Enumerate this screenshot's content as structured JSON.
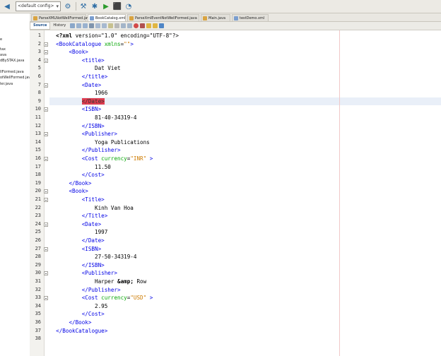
{
  "toolbar": {
    "config": "<default config>",
    "icons": [
      "back-icon",
      "gear-icon",
      "hammer-icon",
      "clean-build-icon",
      "run-icon",
      "debug-icon",
      "profile-icon"
    ]
  },
  "left_panel": {
    "items": [
      "e",
      "tax",
      "ava",
      "dBySTAX.java",
      "llFormed.java",
      "otWellFormed.java",
      "ler.java"
    ]
  },
  "tabs": [
    {
      "label": "ParseXMLNotWellFormed.java",
      "active": false
    },
    {
      "label": "BookCatalog.xml",
      "active": true
    },
    {
      "label": "ParseXmlEventNotWellFormed.java",
      "active": false
    },
    {
      "label": "Main.java",
      "active": false
    },
    {
      "label": "testDemo.xml",
      "active": false
    }
  ],
  "editor_tabs": {
    "source": "Source",
    "history": "History"
  },
  "lines": [
    {
      "n": "1",
      "indent": "",
      "segments": [
        {
          "t": "<?xml ",
          "c": "pi"
        },
        {
          "t": "version=\"1.0\" encoding=\"UTF-8\"?>",
          "c": "txt"
        }
      ]
    },
    {
      "n": "2",
      "indent": "",
      "segments": [
        {
          "t": "<BookCatalogue ",
          "c": "tag"
        },
        {
          "t": "xmlns",
          "c": "attr"
        },
        {
          "t": "=",
          "c": "txt"
        },
        {
          "t": "\"\"",
          "c": "str"
        },
        {
          "t": ">",
          "c": "tag"
        }
      ]
    },
    {
      "n": "3",
      "indent": "    ",
      "segments": [
        {
          "t": "<Book>",
          "c": "tag"
        }
      ]
    },
    {
      "n": "4",
      "indent": "        ",
      "segments": [
        {
          "t": "<title>",
          "c": "tag"
        }
      ]
    },
    {
      "n": "5",
      "indent": "            ",
      "segments": [
        {
          "t": "Dat Viet",
          "c": "txt"
        }
      ]
    },
    {
      "n": "6",
      "indent": "        ",
      "segments": [
        {
          "t": "</title>",
          "c": "tag"
        }
      ]
    },
    {
      "n": "7",
      "indent": "        ",
      "segments": [
        {
          "t": "<Date>",
          "c": "tag"
        }
      ]
    },
    {
      "n": "8",
      "indent": "            ",
      "segments": [
        {
          "t": "1966",
          "c": "txt"
        }
      ]
    },
    {
      "n": "9",
      "indent": "        ",
      "segments": [
        {
          "t": "</Date>",
          "c": "hl"
        }
      ],
      "current": true
    },
    {
      "n": "10",
      "indent": "        ",
      "segments": [
        {
          "t": "<ISBN>",
          "c": "tag"
        }
      ]
    },
    {
      "n": "11",
      "indent": "            ",
      "segments": [
        {
          "t": "81-40-34319-4",
          "c": "txt"
        }
      ]
    },
    {
      "n": "12",
      "indent": "        ",
      "segments": [
        {
          "t": "</ISBN>",
          "c": "tag"
        }
      ]
    },
    {
      "n": "13",
      "indent": "        ",
      "segments": [
        {
          "t": "<Publisher>",
          "c": "tag"
        }
      ]
    },
    {
      "n": "14",
      "indent": "            ",
      "segments": [
        {
          "t": "Yoga Publications",
          "c": "txt"
        }
      ]
    },
    {
      "n": "15",
      "indent": "        ",
      "segments": [
        {
          "t": "</Publisher>",
          "c": "tag"
        }
      ]
    },
    {
      "n": "16",
      "indent": "        ",
      "segments": [
        {
          "t": "<Cost ",
          "c": "tag"
        },
        {
          "t": "currency",
          "c": "attr"
        },
        {
          "t": "=",
          "c": "txt"
        },
        {
          "t": "\"INR\"",
          "c": "str"
        },
        {
          "t": " >",
          "c": "tag"
        }
      ]
    },
    {
      "n": "17",
      "indent": "            ",
      "segments": [
        {
          "t": "11.50",
          "c": "txt"
        }
      ]
    },
    {
      "n": "18",
      "indent": "        ",
      "segments": [
        {
          "t": "</Cost>",
          "c": "tag"
        }
      ]
    },
    {
      "n": "19",
      "indent": "    ",
      "segments": [
        {
          "t": "</Book>",
          "c": "tag"
        }
      ]
    },
    {
      "n": "20",
      "indent": "    ",
      "segments": [
        {
          "t": "<Book>",
          "c": "tag"
        }
      ]
    },
    {
      "n": "21",
      "indent": "        ",
      "segments": [
        {
          "t": "<Title>",
          "c": "tag"
        }
      ]
    },
    {
      "n": "22",
      "indent": "            ",
      "segments": [
        {
          "t": "Kinh Van Hoa",
          "c": "txt"
        }
      ]
    },
    {
      "n": "23",
      "indent": "        ",
      "segments": [
        {
          "t": "</Title>",
          "c": "tag"
        }
      ]
    },
    {
      "n": "24",
      "indent": "        ",
      "segments": [
        {
          "t": "<Date>",
          "c": "tag"
        }
      ]
    },
    {
      "n": "25",
      "indent": "            ",
      "segments": [
        {
          "t": "1997",
          "c": "txt"
        }
      ]
    },
    {
      "n": "26",
      "indent": "        ",
      "segments": [
        {
          "t": "</Date>",
          "c": "tag"
        }
      ]
    },
    {
      "n": "27",
      "indent": "        ",
      "segments": [
        {
          "t": "<ISBN>",
          "c": "tag"
        }
      ]
    },
    {
      "n": "28",
      "indent": "            ",
      "segments": [
        {
          "t": "27-50-34319-4",
          "c": "txt"
        }
      ]
    },
    {
      "n": "29",
      "indent": "        ",
      "segments": [
        {
          "t": "</ISBN>",
          "c": "tag"
        }
      ]
    },
    {
      "n": "30",
      "indent": "        ",
      "segments": [
        {
          "t": "<Publisher>",
          "c": "tag"
        }
      ]
    },
    {
      "n": "31",
      "indent": "            ",
      "segments": [
        {
          "t": "Harper ",
          "c": "txt"
        },
        {
          "t": "&amp;",
          "c": "pi"
        },
        {
          "t": " Row",
          "c": "txt"
        }
      ]
    },
    {
      "n": "32",
      "indent": "        ",
      "segments": [
        {
          "t": "</Publisher>",
          "c": "tag"
        }
      ]
    },
    {
      "n": "33",
      "indent": "        ",
      "segments": [
        {
          "t": "<Cost ",
          "c": "tag"
        },
        {
          "t": "currency",
          "c": "attr"
        },
        {
          "t": "=",
          "c": "txt"
        },
        {
          "t": "\"USD\"",
          "c": "str"
        },
        {
          "t": " >",
          "c": "tag"
        }
      ]
    },
    {
      "n": "34",
      "indent": "            ",
      "segments": [
        {
          "t": "2.95",
          "c": "txt"
        }
      ]
    },
    {
      "n": "35",
      "indent": "        ",
      "segments": [
        {
          "t": "</Cost>",
          "c": "tag"
        }
      ]
    },
    {
      "n": "36",
      "indent": "    ",
      "segments": [
        {
          "t": "</Book>",
          "c": "tag"
        }
      ]
    },
    {
      "n": "37",
      "indent": "",
      "segments": [
        {
          "t": "</BookCatalogue>",
          "c": "tag"
        }
      ]
    },
    {
      "n": "38",
      "indent": "",
      "segments": []
    }
  ]
}
